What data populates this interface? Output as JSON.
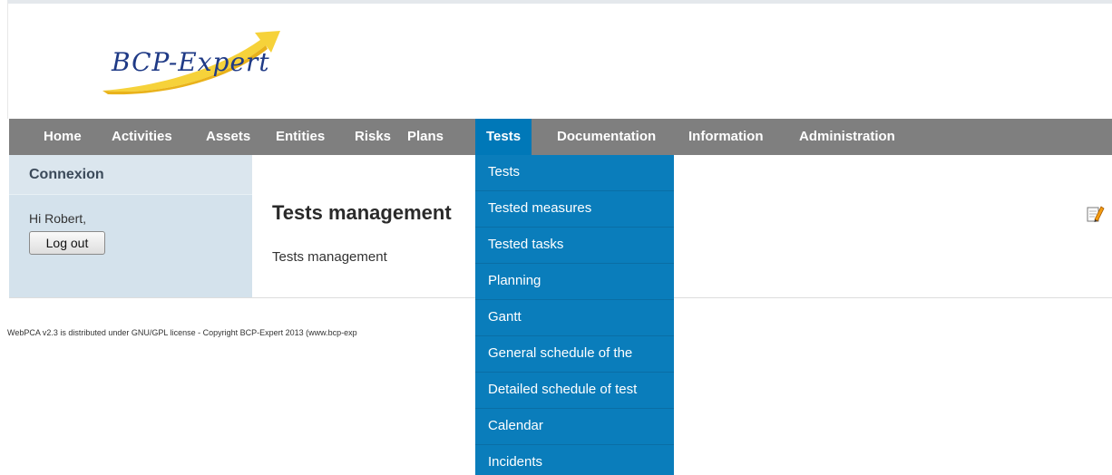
{
  "brand": {
    "logo_text": "BCP-Expert"
  },
  "nav": {
    "items": [
      {
        "label": "Home"
      },
      {
        "label": "Activities"
      },
      {
        "label": "Assets"
      },
      {
        "label": "Entities"
      },
      {
        "label": "Risks"
      },
      {
        "label": "Plans"
      },
      {
        "label": "Tests"
      },
      {
        "label": "Documentation"
      },
      {
        "label": "Information"
      },
      {
        "label": "Administration"
      }
    ],
    "active": "Tests"
  },
  "sidebar": {
    "title": "Connexion",
    "greeting": "Hi Robert,",
    "logout_label": "Log out"
  },
  "main": {
    "title": "Tests management",
    "description": "Tests management"
  },
  "dropdown": {
    "items": [
      {
        "label": "Tests"
      },
      {
        "label": "Tested measures"
      },
      {
        "label": "Tested tasks"
      },
      {
        "label": "Planning"
      },
      {
        "label": "Gantt"
      },
      {
        "label": "General schedule of the"
      },
      {
        "label": "Detailed schedule of test"
      },
      {
        "label": "Calendar"
      },
      {
        "label": "Incidents"
      }
    ]
  },
  "footer": {
    "text": "WebPCA v2.3 is distributed under GNU/GPL license - Copyright BCP-Expert 2013 (www.bcp-exp"
  },
  "colors": {
    "nav_bg": "#7f7f7f",
    "active_bg": "#0078b8",
    "dropdown_bg": "#0a7dbb",
    "sidebar_bg": "#d4e2ec"
  },
  "icons": {
    "edit": "pencil-notepad-icon"
  }
}
